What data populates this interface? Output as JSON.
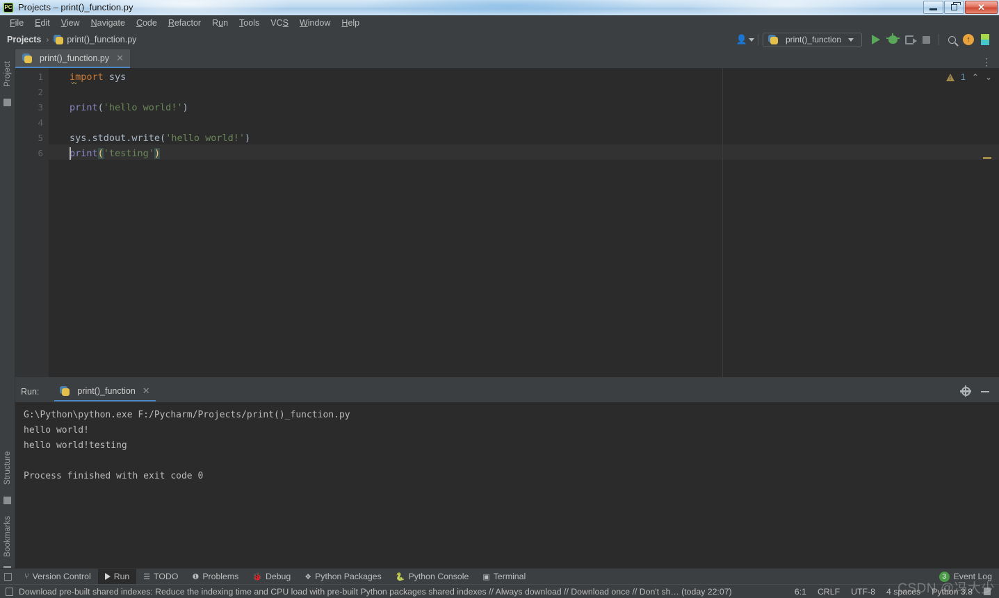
{
  "window": {
    "title": "Projects – print()_function.py",
    "app_icon": "pycharm-icon",
    "controls": {
      "minimize": "minimize",
      "restore": "restore",
      "close": "close"
    }
  },
  "menubar": {
    "items": [
      {
        "label": "File",
        "mnemonic": "F"
      },
      {
        "label": "Edit",
        "mnemonic": "E"
      },
      {
        "label": "View",
        "mnemonic": "V"
      },
      {
        "label": "Navigate",
        "mnemonic": "N"
      },
      {
        "label": "Code",
        "mnemonic": "C"
      },
      {
        "label": "Refactor",
        "mnemonic": "R"
      },
      {
        "label": "Run",
        "mnemonic": "u"
      },
      {
        "label": "Tools",
        "mnemonic": "T"
      },
      {
        "label": "VCS",
        "mnemonic": "S"
      },
      {
        "label": "Window",
        "mnemonic": "W"
      },
      {
        "label": "Help",
        "mnemonic": "H"
      }
    ]
  },
  "navbar": {
    "breadcrumb_root": "Projects",
    "breadcrumb_separator": "›",
    "breadcrumb_file": "print()_function.py",
    "run_config": "print()_function",
    "icons": [
      "user-icon",
      "run-button",
      "debug-button",
      "coverage-button",
      "stop-button",
      "search-icon",
      "update-icon",
      "run-anything-icon"
    ]
  },
  "left_strip": {
    "project_tab": "Project",
    "structure_tab": "Structure",
    "bookmarks_tab": "Bookmarks"
  },
  "editor": {
    "tab_label": "print()_function.py",
    "warnings_count": "1",
    "lines": [
      {
        "n": "1",
        "tokens": [
          {
            "t": "import",
            "c": "kw"
          },
          {
            "t": " sys",
            "c": "ident"
          }
        ]
      },
      {
        "n": "2",
        "tokens": []
      },
      {
        "n": "3",
        "tokens": [
          {
            "t": "print",
            "c": "fn"
          },
          {
            "t": "(",
            "c": "punct"
          },
          {
            "t": "'hello world!'",
            "c": "str"
          },
          {
            "t": ")",
            "c": "punct"
          }
        ]
      },
      {
        "n": "4",
        "tokens": []
      },
      {
        "n": "5",
        "tokens": [
          {
            "t": "sys.stdout.write",
            "c": "ident"
          },
          {
            "t": "(",
            "c": "punct"
          },
          {
            "t": "'hello world!'",
            "c": "str"
          },
          {
            "t": ")",
            "c": "punct"
          }
        ]
      },
      {
        "n": "6",
        "tokens": [
          {
            "t": "print",
            "c": "fn"
          },
          {
            "t": "(",
            "c": "brace-hl"
          },
          {
            "t": "'testing'",
            "c": "str"
          },
          {
            "t": ")",
            "c": "brace-hl"
          }
        ]
      }
    ]
  },
  "run_panel": {
    "label": "Run:",
    "tab": "print()_function",
    "output": [
      "G:\\Python\\python.exe F:/Pycharm/Projects/print()_function.py",
      "hello world!",
      "hello world!testing",
      "",
      "Process finished with exit code 0"
    ],
    "header_icons": [
      "gear-icon",
      "minimize-icon"
    ]
  },
  "bottom_bar": {
    "tabs": [
      {
        "label": "Version Control",
        "icon": "branch-icon",
        "active": false
      },
      {
        "label": "Run",
        "icon": "run-icon",
        "active": true
      },
      {
        "label": "TODO",
        "icon": "todo-icon",
        "active": false
      },
      {
        "label": "Problems",
        "icon": "problems-icon",
        "active": false
      },
      {
        "label": "Debug",
        "icon": "debug-icon",
        "active": false
      },
      {
        "label": "Python Packages",
        "icon": "packages-icon",
        "active": false
      },
      {
        "label": "Python Console",
        "icon": "python-console-icon",
        "active": false
      },
      {
        "label": "Terminal",
        "icon": "terminal-icon",
        "active": false
      }
    ],
    "event_log": "Event Log",
    "event_log_count": "3"
  },
  "status_bar": {
    "notification": "Download pre-built shared indexes: Reduce the indexing time and CPU load with pre-built Python packages shared indexes // Always download // Download once // Don't sh… (today 22:07)",
    "caret": "6:1",
    "line_sep": "CRLF",
    "encoding": "UTF-8",
    "indent": "4 spaces",
    "interpreter": "Python 3.8"
  },
  "watermark": "CSDN @冯大少",
  "colors": {
    "editor_bg": "#2b2b2b",
    "chrome_bg": "#3c3f41",
    "gutter_bg": "#313335",
    "accent_blue": "#4a88c7",
    "keyword": "#cc7832",
    "string": "#6a8759",
    "function": "#8888c6",
    "identifier": "#a9b7c6",
    "brace_match": "#ffc66d",
    "run_green": "#5aa75a",
    "badge_green": "#4a9b48"
  }
}
